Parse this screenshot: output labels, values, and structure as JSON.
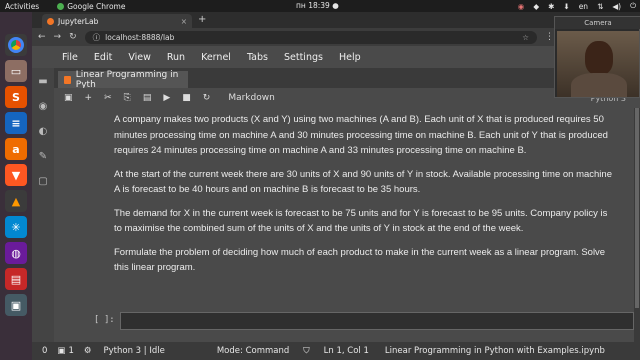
{
  "os": {
    "activities": "Activities",
    "active_app": "Google Chrome",
    "clock": "пн 18:39 ●",
    "lang": "en"
  },
  "launcher": {
    "icons": [
      "chrome-icon",
      "files-icon",
      "jupyter-icon",
      "writer-icon",
      "amazon-icon",
      "brave-icon",
      "vlc-icon",
      "sky-icon",
      "network-icon",
      "presentation-icon",
      "terminal-icon"
    ]
  },
  "browser": {
    "tab_title": "JupyterLab",
    "url": "localhost:8888/lab"
  },
  "menu": {
    "items": [
      "File",
      "Edit",
      "View",
      "Run",
      "Kernel",
      "Tabs",
      "Settings",
      "Help"
    ]
  },
  "notebook": {
    "tab_title": "Linear Programming in Pyth",
    "cell_type": "Markdown",
    "kernel_label": "Python 3",
    "paragraphs": [
      "A company makes two products (X and Y) using two machines (A and B). Each unit of X that is produced requires 50 minutes processing time on machine A and 30 minutes processing time on machine B. Each unit of Y that is produced requires 24 minutes processing time on machine A and 33 minutes processing time on machine B.",
      "At the start of the current week there are 30 units of X and 90 units of Y in stock. Available processing time on machine A is forecast to be 40 hours and on machine B is forecast to be 35 hours.",
      "The demand for X in the current week is forecast to be 75 units and for Y is forecast to be 95 units. Company policy is to maximise the combined sum of the units of X and the units of Y in stock at the end of the week.",
      "Formulate the problem of deciding how much of each product to make in the current week as a linear program. Solve this linear program."
    ],
    "code_prompt": "[ ]:"
  },
  "status": {
    "count": "0",
    "count2": "1",
    "kernel_status": "Python 3 | Idle",
    "mode": "Mode: Command",
    "position": "Ln 1, Col 1",
    "filename": "Linear Programming in Python with Examples.ipynb"
  },
  "camera": {
    "title": "Camera"
  }
}
